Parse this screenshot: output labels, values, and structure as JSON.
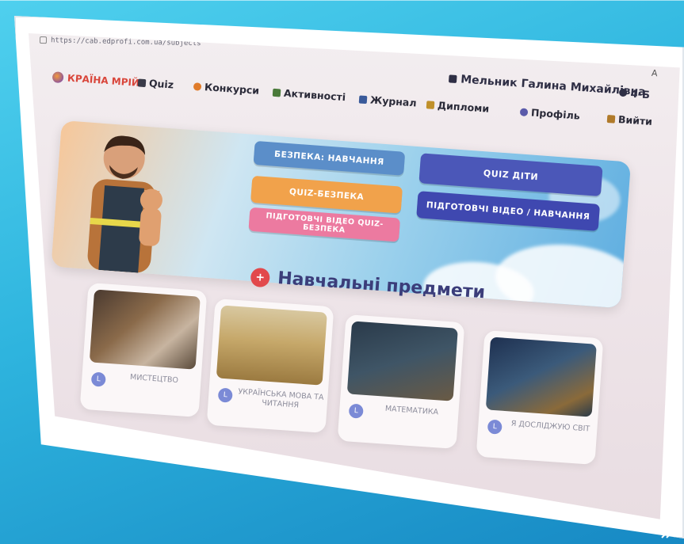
{
  "browser": {
    "url": "https://cab.edprofi.com.ua/subjects"
  },
  "top_right_text": "A",
  "header": {
    "logo_text": "КРАЇНА МРІЙ",
    "nav": [
      {
        "label": "Quiz",
        "icon": "gamepad-icon",
        "color": "#3a3a48"
      },
      {
        "label": "Конкурси",
        "icon": "palette-icon",
        "color": "#e07b2a"
      },
      {
        "label": "Активності",
        "icon": "people-icon",
        "color": "#4a7a3a"
      },
      {
        "label": "Журнал",
        "icon": "book-icon",
        "color": "#3a5a9a"
      },
      {
        "label": "Дипломи",
        "icon": "trophy-icon",
        "color": "#c0902a"
      },
      {
        "label": "Профіль",
        "icon": "profile-icon",
        "color": "#5a5aaa"
      },
      {
        "label": "Вийти",
        "icon": "exit-icon",
        "color": "#b07a2a"
      }
    ],
    "user_name": "Мельник Галина Михайлівна",
    "grade": "4-Б"
  },
  "banner": {
    "buttons": [
      {
        "label": "БЕЗПЕКА: НАВЧАННЯ",
        "color": "#5b8ec9"
      },
      {
        "label": "QUIZ ДІТИ",
        "color": "#4b57b8"
      },
      {
        "label": "QUIZ-БЕЗПЕКА",
        "color": "#f1a24b"
      },
      {
        "label": "ПІДГОТОВЧІ ВІДЕО / НАВЧАННЯ",
        "color": "#3f48b0"
      },
      {
        "label": "ПІДГОТОВЧІ ВІДЕО QUIZ-БЕЗПЕКА",
        "color": "#ec7aa0"
      }
    ]
  },
  "section_title": "Навчальні предмети",
  "subjects": [
    {
      "label": "МИСТЕЦТВО",
      "badge": "L"
    },
    {
      "label": "УКРАЇНСЬКА МОВА ТА ЧИТАННЯ",
      "badge": "L"
    },
    {
      "label": "МАТЕМАТИКА",
      "badge": "L"
    },
    {
      "label": "Я ДОСЛІДЖУЮ СВІТ",
      "badge": "L"
    }
  ]
}
